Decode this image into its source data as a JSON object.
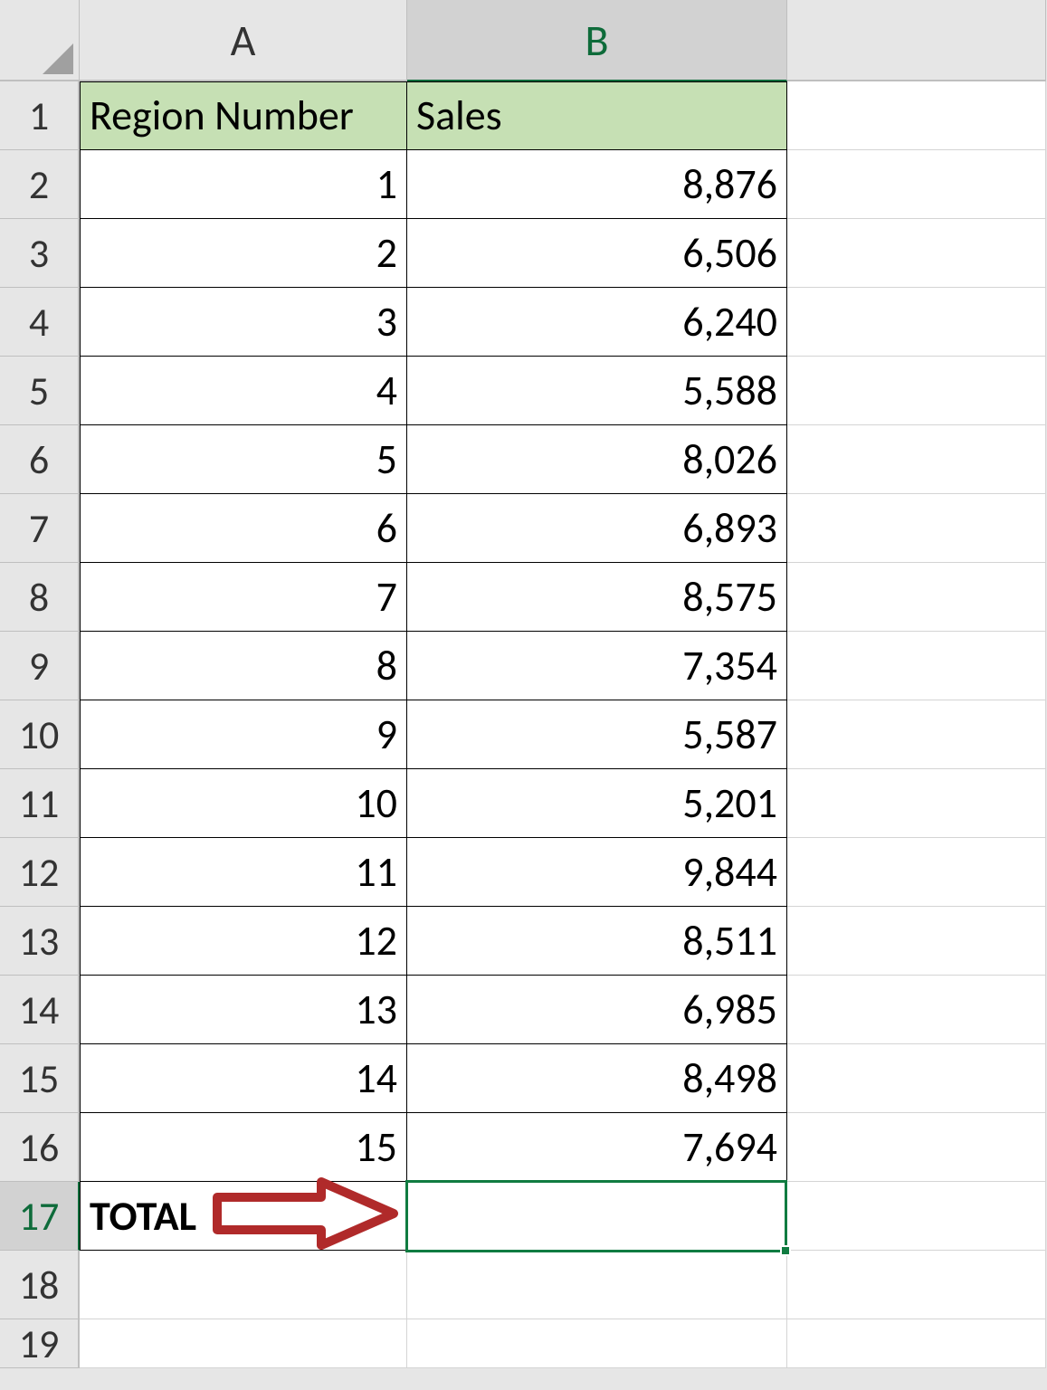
{
  "columns": [
    "A",
    "B"
  ],
  "headers": {
    "A": "Region Number",
    "B": "Sales"
  },
  "rows": [
    {
      "n": "1",
      "A": "1",
      "B": "8,876"
    },
    {
      "n": "2",
      "A": "2",
      "B": "6,506"
    },
    {
      "n": "3",
      "A": "3",
      "B": "6,240"
    },
    {
      "n": "4",
      "A": "4",
      "B": "5,588"
    },
    {
      "n": "5",
      "A": "5",
      "B": "8,026"
    },
    {
      "n": "6",
      "A": "6",
      "B": "6,893"
    },
    {
      "n": "7",
      "A": "7",
      "B": "8,575"
    },
    {
      "n": "8",
      "A": "8",
      "B": "7,354"
    },
    {
      "n": "9",
      "A": "9",
      "B": "5,587"
    },
    {
      "n": "10",
      "A": "10",
      "B": "5,201"
    },
    {
      "n": "11",
      "A": "11",
      "B": "9,844"
    },
    {
      "n": "12",
      "A": "12",
      "B": "8,511"
    },
    {
      "n": "13",
      "A": "13",
      "B": "6,985"
    },
    {
      "n": "14",
      "A": "14",
      "B": "8,498"
    },
    {
      "n": "15",
      "A": "15",
      "B": "7,694"
    }
  ],
  "total_label": "TOTAL",
  "row_headers": [
    "1",
    "2",
    "3",
    "4",
    "5",
    "6",
    "7",
    "8",
    "9",
    "10",
    "11",
    "12",
    "13",
    "14",
    "15",
    "16",
    "17",
    "18",
    "19"
  ],
  "selected_cell": "B17",
  "annotation": {
    "type": "arrow",
    "color": "#b02a2a"
  }
}
